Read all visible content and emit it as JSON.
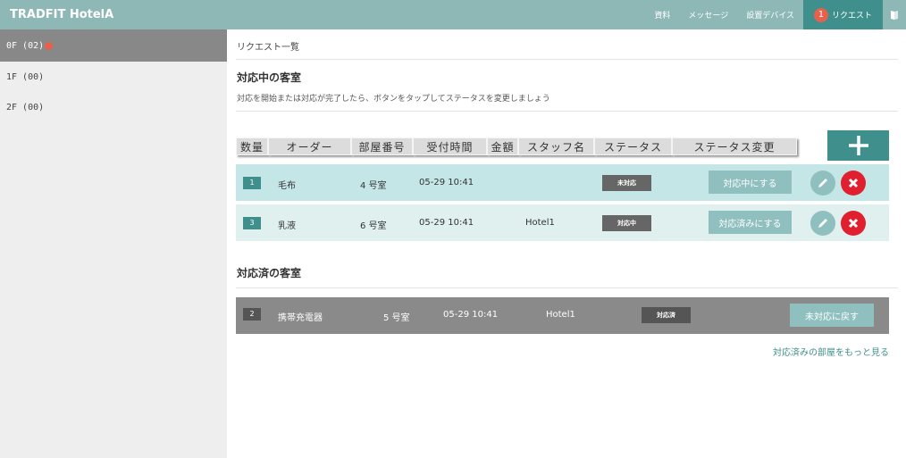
{
  "app": {
    "title": "TRADFIT HotelA"
  },
  "nav": {
    "links": [
      "資料",
      "メッセージ",
      "設置デバイス"
    ],
    "requests": {
      "count": "1",
      "label": "リクエスト"
    }
  },
  "sidebar": {
    "floors": [
      {
        "label": "0F (02)",
        "active": true,
        "alert": true
      },
      {
        "label": "1F (00)"
      },
      {
        "label": "2F (00)"
      }
    ]
  },
  "main": {
    "breadcrumb": "リクエスト一覧",
    "active_section": {
      "title": "対応中の客室",
      "note": "対応を開始または対応が完了したら、ボタンをタップしてステータスを変更しましょう"
    },
    "table_headers": [
      "数量",
      "オーダー",
      "部屋番号",
      "受付時間",
      "金額",
      "スタッフ名",
      "ステータス",
      "ステータス変更"
    ],
    "add_label": "+",
    "active_rows": [
      {
        "qty": "1",
        "order": "毛布",
        "room": "4 号室",
        "time": "05-29 10:41",
        "staff": "",
        "status": "未対応",
        "action": "対応中にする"
      },
      {
        "qty": "3",
        "order": "乳液",
        "room": "6 号室",
        "time": "05-29 10:41",
        "staff": "Hotel1",
        "status": "対応中",
        "action": "対応済みにする"
      }
    ],
    "done_section": {
      "title": "対応済の客室"
    },
    "done_rows": [
      {
        "qty": "2",
        "order": "携帯充電器",
        "room": "5 号室",
        "time": "05-29 10:41",
        "staff": "Hotel1",
        "status": "対応済",
        "action": "未対応に戻す"
      }
    ],
    "more_link": "対応済みの部屋をもっと見る"
  },
  "colors": {
    "topbar": "#8db8b6",
    "accent": "#3f8f8c",
    "alert": "#e8604c",
    "delete": "#e0202e",
    "button": "#8fc0bf"
  }
}
